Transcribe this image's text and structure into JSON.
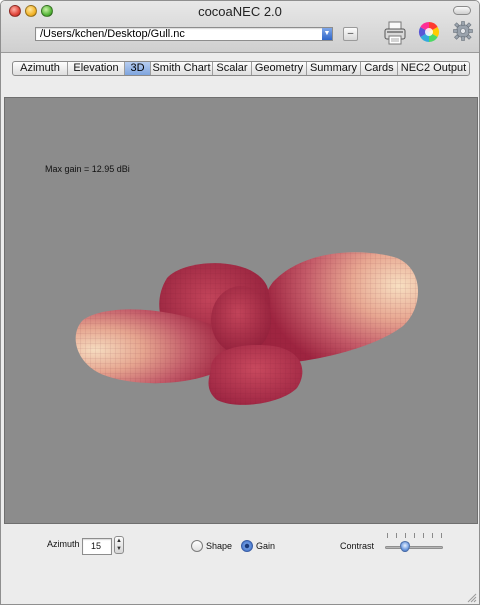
{
  "window": {
    "title": "cocoaNEC 2.0"
  },
  "toolbar": {
    "file_path": "/Users/kchen/Desktop/Gull.nc",
    "minus_label": "–"
  },
  "tabs": [
    {
      "label": "Azimuth",
      "selected": false
    },
    {
      "label": "Elevation",
      "selected": false
    },
    {
      "label": "3D",
      "selected": true
    },
    {
      "label": "Smith Chart",
      "selected": false
    },
    {
      "label": "Scalar",
      "selected": false
    },
    {
      "label": "Geometry",
      "selected": false
    },
    {
      "label": "Summary",
      "selected": false
    },
    {
      "label": "Cards",
      "selected": false
    },
    {
      "label": "NEC2 Output",
      "selected": false
    }
  ],
  "view": {
    "max_gain_text": "Max gain = 12.95 dBi",
    "background_color": "#8c8c8c",
    "lobe_colors": {
      "peak": "#f6dcc0",
      "mid": "#d98c8c",
      "low": "#9e2440"
    }
  },
  "controls": {
    "azimuth_label": "Azimuth",
    "azimuth_value": "15",
    "shape_label": "Shape",
    "gain_label": "Gain",
    "selected_mode": "Gain",
    "contrast_label": "Contrast",
    "contrast_level": 0.3
  }
}
